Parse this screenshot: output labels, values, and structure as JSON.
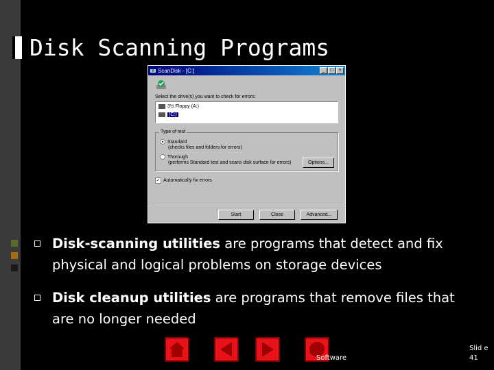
{
  "slide": {
    "title": "Disk Scanning Programs",
    "bullets": [
      {
        "bold": "Disk-scanning utilities",
        "rest": " are programs that detect and fix physical and logical problems on storage devices"
      },
      {
        "bold": "Disk cleanup utilities",
        "rest": " are programs that remove files that are no longer needed"
      }
    ],
    "footer": "Software",
    "slide_number": "Slid e 41"
  },
  "dialog": {
    "title": "ScanDisk - [C:]",
    "controls": [
      "_",
      "□",
      "×"
    ],
    "prompt": "Select the drive(s) you want to check for errors:",
    "drives": [
      "3½ Floppy (A:)",
      "(C:)"
    ],
    "test_group_label": "Type of test",
    "standard_label": "Standard",
    "standard_desc": "(checks files and folders for errors)",
    "thorough_label": "Thorough",
    "thorough_desc": "(performs Standard test and scans disk surface for errors)",
    "options_button": "Options...",
    "autofix_label": "Automatically fix errors",
    "start_button": "Start",
    "close_button": "Close",
    "advanced_button": "Advanced..."
  },
  "nav": [
    "home",
    "previous",
    "next",
    "end"
  ],
  "colors": {
    "background": "#000000",
    "nav_button": "#e8121a",
    "titlebar": "#00007b"
  }
}
